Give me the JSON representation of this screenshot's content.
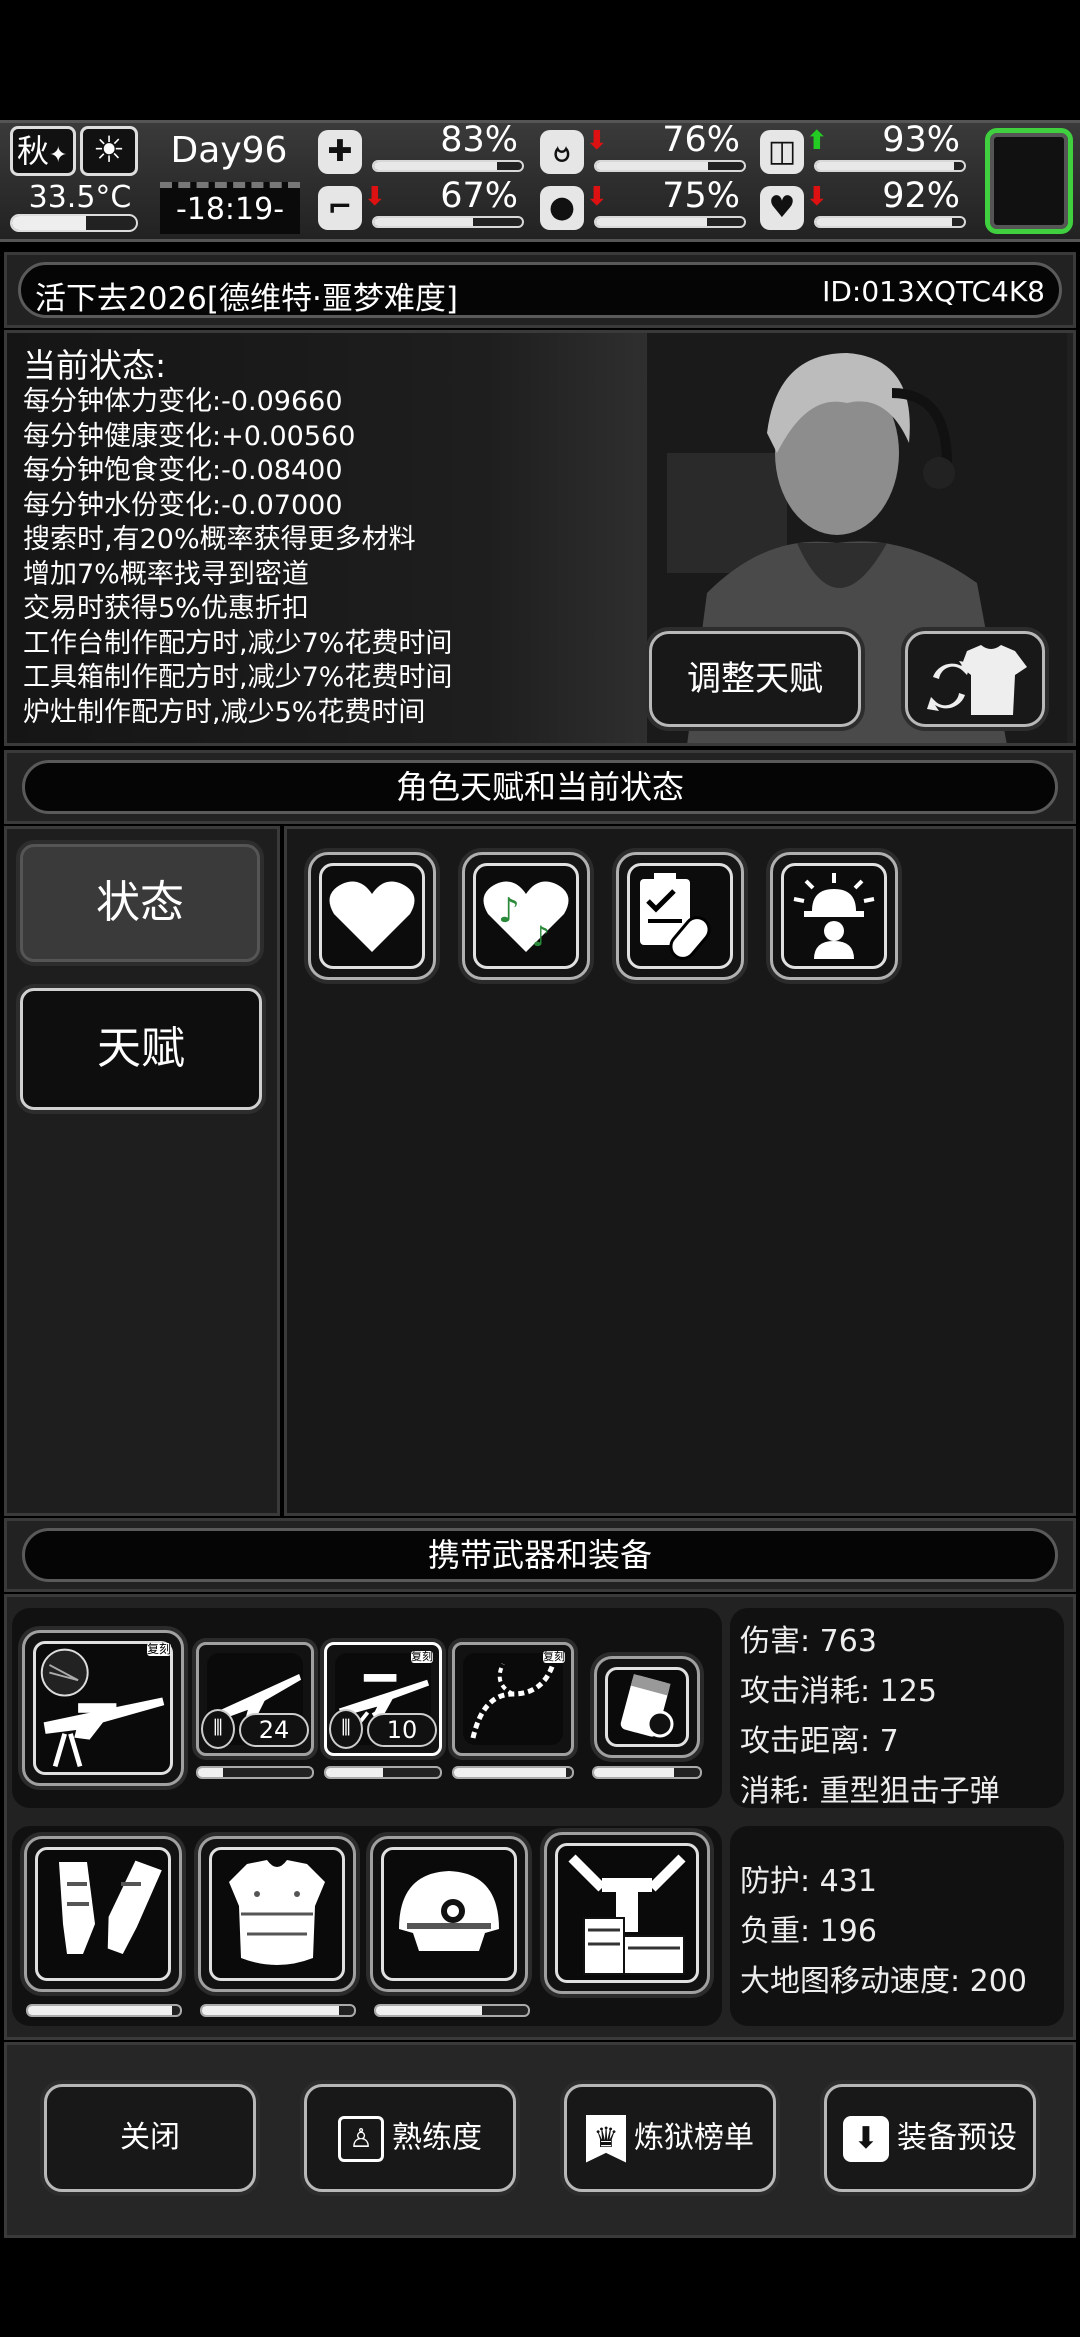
{
  "hud": {
    "season": "秋",
    "temperature": "33.5°C",
    "temperature_fill": 0.6,
    "day": "Day96",
    "time": "-18:19-",
    "stats": [
      {
        "name": "health",
        "icon": "medkit-icon",
        "pct": "83%",
        "fill": 0.83,
        "arrow": ""
      },
      {
        "name": "hunger",
        "icon": "stomach-icon",
        "pct": "76%",
        "fill": 0.76,
        "arrow": "down"
      },
      {
        "name": "energy",
        "icon": "capsule-icon",
        "pct": "93%",
        "fill": 0.93,
        "arrow": "up"
      },
      {
        "name": "stamina",
        "icon": "boot-icon",
        "pct": "67%",
        "fill": 0.67,
        "arrow": "down"
      },
      {
        "name": "thirst",
        "icon": "water-drop-icon",
        "pct": "75%",
        "fill": 0.75,
        "arrow": "down"
      },
      {
        "name": "mood",
        "icon": "heart-icon",
        "pct": "92%",
        "fill": 0.92,
        "arrow": "down"
      }
    ],
    "arrow_up_color": "#22cc22",
    "arrow_down_color": "#dd1111",
    "slot_color": "#3fcf3f"
  },
  "header": {
    "title": "活下去2026[德维特·噩梦难度]",
    "id": "ID:013XQTC4K8"
  },
  "status": {
    "heading": "当前状态:",
    "lines": [
      "每分钟体力变化:-0.09660",
      "每分钟健康变化:+0.00560",
      "每分钟饱食变化:-0.08400",
      "每分钟水份变化:-0.07000",
      "搜索时,有20%概率获得更多材料",
      "增加7%概率找寻到密道",
      "交易时获得5%优惠折扣",
      "工作台制作配方时,减少7%花费时间",
      "工具箱制作配方时,减少7%花费时间",
      "炉灶制作配方时,减少5%花费时间"
    ],
    "adjust_button": "调整天赋"
  },
  "talent_section": {
    "title": "角色天赋和当前状态",
    "tabs": [
      "状态",
      "天赋"
    ],
    "icons": [
      "heart-icon",
      "music-heart-icon",
      "clipboard-pill-icon",
      "alarm-person-icon"
    ]
  },
  "equipment_section": {
    "title": "携带武器和装备",
    "weapons": [
      {
        "icon": "sniper-rifle-icon",
        "tag": "复刻",
        "fill": 0.95
      },
      {
        "icon": "assault-rifle-icon",
        "ammo": "24",
        "fill": 0.22
      },
      {
        "icon": "scoped-rifle-icon",
        "tag": "复刻",
        "ammo": "10",
        "fill": 0.5
      },
      {
        "icon": "chain-whip-icon",
        "tag": "复刻",
        "fill": 0.95
      },
      {
        "icon": "flashlight-icon",
        "fill": 0.75
      }
    ],
    "weapon_stats": [
      "伤害: 763",
      "攻击消耗: 125",
      "攻击距离: 7",
      "消耗: 重型狙击子弹"
    ],
    "armor": [
      {
        "icon": "arm-guards-icon",
        "fill": 0.95
      },
      {
        "icon": "body-armor-icon",
        "fill": 0.9
      },
      {
        "icon": "tactical-helmet-icon",
        "fill": 0.7
      },
      {
        "icon": "backpack-frame-icon",
        "fill": 0
      }
    ],
    "armor_stats": [
      "防护: 431",
      "负重: 196",
      "大地图移动速度: 200"
    ]
  },
  "bottom": {
    "close": "关闭",
    "proficiency": "熟练度",
    "ranking": "炼狱榜单",
    "preset": "装备预设"
  }
}
